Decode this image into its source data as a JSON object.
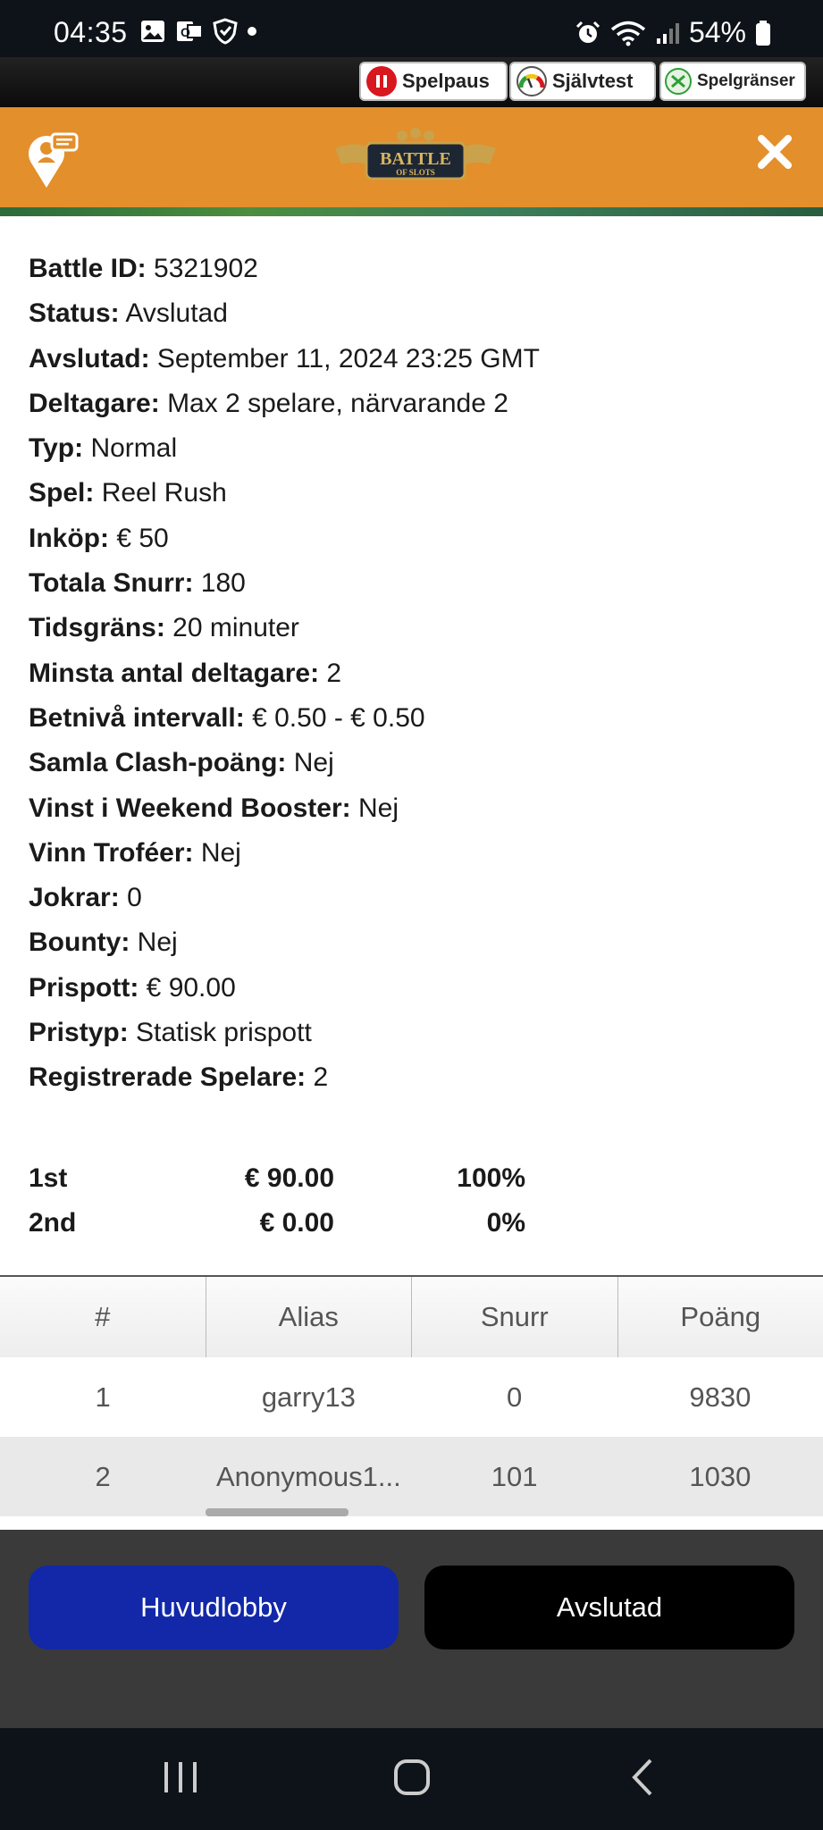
{
  "status_bar": {
    "time": "04:35",
    "battery": "54%"
  },
  "rg_bar": {
    "pause": "Spelpaus",
    "selftest": "Självtest",
    "limits": "Spelgränser"
  },
  "header": {
    "logo_top": "BATTLE",
    "logo_bottom": "OF SLOTS"
  },
  "details": [
    {
      "label": "Battle ID:",
      "value": "5321902"
    },
    {
      "label": "Status:",
      "value": "Avslutad"
    },
    {
      "label": "Avslutad:",
      "value": "September 11, 2024 23:25 GMT"
    },
    {
      "label": "Deltagare:",
      "value": "Max 2 spelare, närvarande 2"
    },
    {
      "label": "Typ:",
      "value": "Normal"
    },
    {
      "label": "Spel:",
      "value": "Reel Rush"
    },
    {
      "label": "Inköp:",
      "value": "€ 50"
    },
    {
      "label": "Totala Snurr:",
      "value": "180"
    },
    {
      "label": "Tidsgräns:",
      "value": "20 minuter"
    },
    {
      "label": "Minsta antal deltagare:",
      "value": "2"
    },
    {
      "label": "Betnivå intervall:",
      "value": "€ 0.50 - € 0.50"
    },
    {
      "label": "Samla Clash-poäng:",
      "value": "Nej"
    },
    {
      "label": "Vinst i Weekend Booster:",
      "value": "Nej"
    },
    {
      "label": "Vinn Troféer:",
      "value": "Nej"
    },
    {
      "label": "Jokrar:",
      "value": "0"
    },
    {
      "label": "Bounty:",
      "value": "Nej"
    },
    {
      "label": "Prispott:",
      "value": "€ 90.00"
    },
    {
      "label": "Pristyp:",
      "value": "Statisk prispott"
    },
    {
      "label": "Registrerade Spelare:",
      "value": "2"
    }
  ],
  "prizes": [
    {
      "place": "1st",
      "amount": "€ 90.00",
      "percent": "100%"
    },
    {
      "place": "2nd",
      "amount": "€ 0.00",
      "percent": "0%"
    }
  ],
  "table": {
    "headers": [
      "#",
      "Alias",
      "Snurr",
      "Poäng"
    ],
    "rows": [
      [
        "1",
        "garry13",
        "0",
        "9830"
      ],
      [
        "2",
        "Anonymous1...",
        "101",
        "1030"
      ]
    ]
  },
  "buttons": {
    "lobby": "Huvudlobby",
    "ended": "Avslutad"
  },
  "colors": {
    "header": "#e38f2c",
    "lobby_button": "#1228a8",
    "ended_button": "#000000"
  }
}
